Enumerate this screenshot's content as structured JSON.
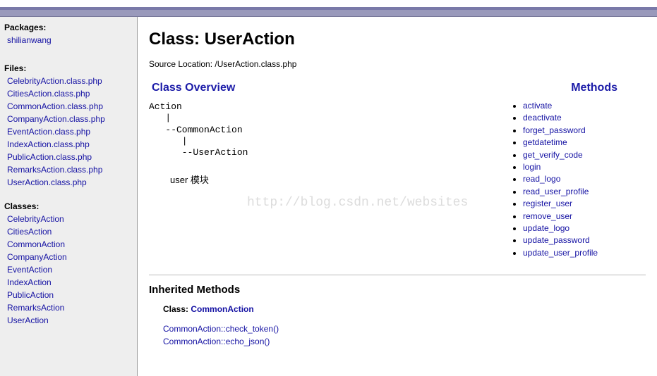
{
  "sidebar": {
    "packages_heading": "Packages:",
    "packages": [
      {
        "label": "shilianwang"
      }
    ],
    "files_heading": "Files:",
    "files": [
      {
        "label": "CelebrityAction.class.php"
      },
      {
        "label": "CitiesAction.class.php"
      },
      {
        "label": "CommonAction.class.php"
      },
      {
        "label": "CompanyAction.class.php"
      },
      {
        "label": "EventAction.class.php"
      },
      {
        "label": "IndexAction.class.php"
      },
      {
        "label": "PublicAction.class.php"
      },
      {
        "label": "RemarksAction.class.php"
      },
      {
        "label": "UserAction.class.php"
      }
    ],
    "classes_heading": "Classes:",
    "classes": [
      {
        "label": "CelebrityAction"
      },
      {
        "label": "CitiesAction"
      },
      {
        "label": "CommonAction"
      },
      {
        "label": "CompanyAction"
      },
      {
        "label": "EventAction"
      },
      {
        "label": "IndexAction"
      },
      {
        "label": "PublicAction"
      },
      {
        "label": "RemarksAction"
      },
      {
        "label": "UserAction"
      }
    ]
  },
  "main": {
    "title": "Class: UserAction",
    "source_location": "Source Location: /UserAction.class.php",
    "overview_heading": "Class Overview",
    "class_tree": "Action\n   |\n   --CommonAction\n      |\n      --UserAction",
    "description": "user 模块",
    "methods_heading": "Methods",
    "methods": [
      {
        "label": "activate"
      },
      {
        "label": "deactivate"
      },
      {
        "label": "forget_password"
      },
      {
        "label": "getdatetime"
      },
      {
        "label": "get_verify_code"
      },
      {
        "label": "login"
      },
      {
        "label": "read_logo"
      },
      {
        "label": "read_user_profile"
      },
      {
        "label": "register_user"
      },
      {
        "label": "remove_user"
      },
      {
        "label": "update_logo"
      },
      {
        "label": "update_password"
      },
      {
        "label": "update_user_profile"
      }
    ],
    "inherited_heading": "Inherited Methods",
    "inherited_class_prefix": "Class: ",
    "inherited_class": "CommonAction",
    "inherited_methods": [
      {
        "label": "CommonAction::check_token()"
      },
      {
        "label": "CommonAction::echo_json()"
      }
    ]
  },
  "watermark": "http://blog.csdn.net/websites"
}
